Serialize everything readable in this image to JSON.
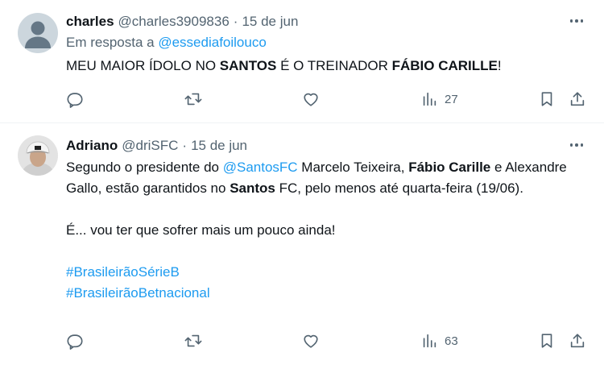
{
  "tweets": [
    {
      "name": "charles",
      "handle": "@charles3909836",
      "separator": "·",
      "date": "15 de jun",
      "reply_prefix": "Em resposta a",
      "reply_handle": "@essediafoilouco",
      "text": {
        "p1": "MEU MAIOR ÍDOLO NO ",
        "b1": "SANTOS",
        "p2": " É O TREINADOR ",
        "b2": "FÁBIO CARILLE",
        "p3": "!"
      },
      "views": "27"
    },
    {
      "name": "Adriano",
      "handle": "@driSFC",
      "separator": "·",
      "date": "15 de jun",
      "text": {
        "p1": "Segundo o presidente do ",
        "mention": "@SantosFC",
        "p2": " Marcelo Teixeira, ",
        "b1": "Fábio Carille",
        "p3": " e Alexandre Gallo, estão garantidos no ",
        "b2": "Santos",
        "p4": " FC, pelo menos até quarta-feira (19/06).",
        "line2": "É... vou ter que sofrer mais um pouco ainda!",
        "hashtag1": "#BrasileirãoSérieB",
        "hashtag2": "#BrasileirãoBetnacional"
      },
      "views": "63"
    }
  ],
  "icons": {
    "more": "more-horizontal-icon",
    "reply": "reply-icon",
    "retweet": "retweet-icon",
    "like": "heart-icon",
    "views": "views-chart-icon",
    "bookmark": "bookmark-icon",
    "share": "share-icon"
  },
  "colors": {
    "text": "#0f1419",
    "secondary": "#536471",
    "link": "#1d9bf0",
    "divider": "#eff3f4"
  }
}
